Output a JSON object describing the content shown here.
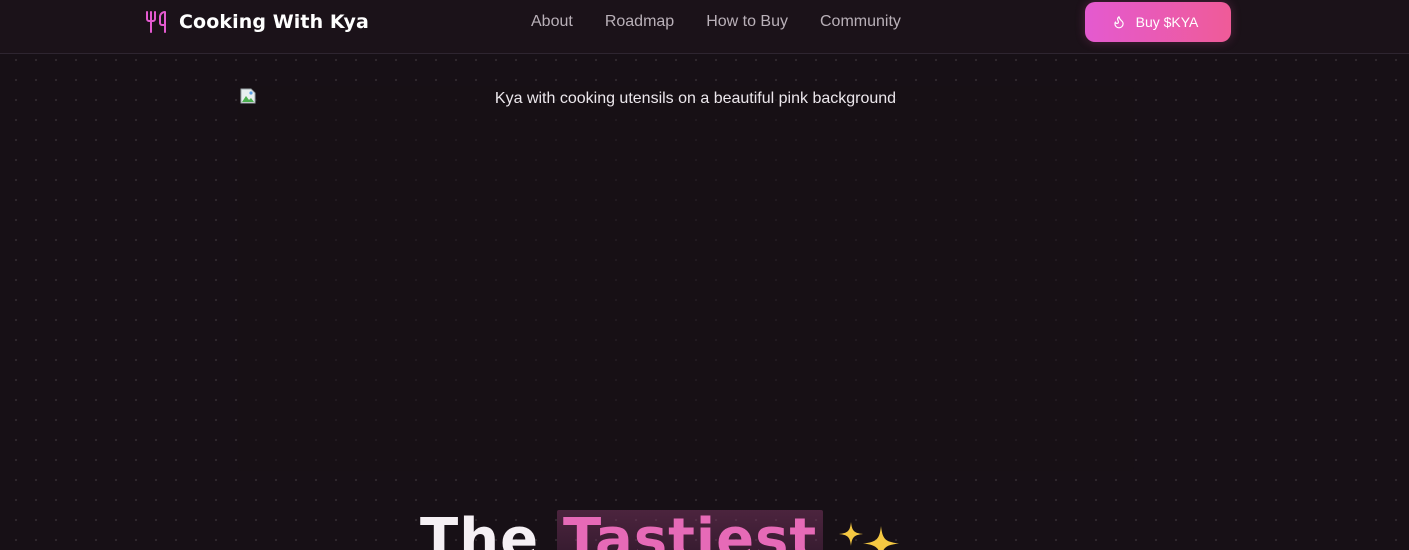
{
  "header": {
    "brand": "Cooking With Kya",
    "nav": [
      "About",
      "Roadmap",
      "How to Buy",
      "Community"
    ],
    "buy_label": "Buy $KYA"
  },
  "hero": {
    "image_alt": "Kya with cooking utensils on a beautiful pink background",
    "heading_word1": "The",
    "heading_word2": "Tastiest"
  },
  "colors": {
    "accent_pink": "#e45ad0",
    "accent_rose": "#ef5b98",
    "background": "#171016",
    "sparkle": "#f5c842"
  },
  "icons": {
    "brand": "fork-knife-icon",
    "buy": "flame-icon",
    "image": "broken-image-icon",
    "heading": "sparkles-icon"
  }
}
